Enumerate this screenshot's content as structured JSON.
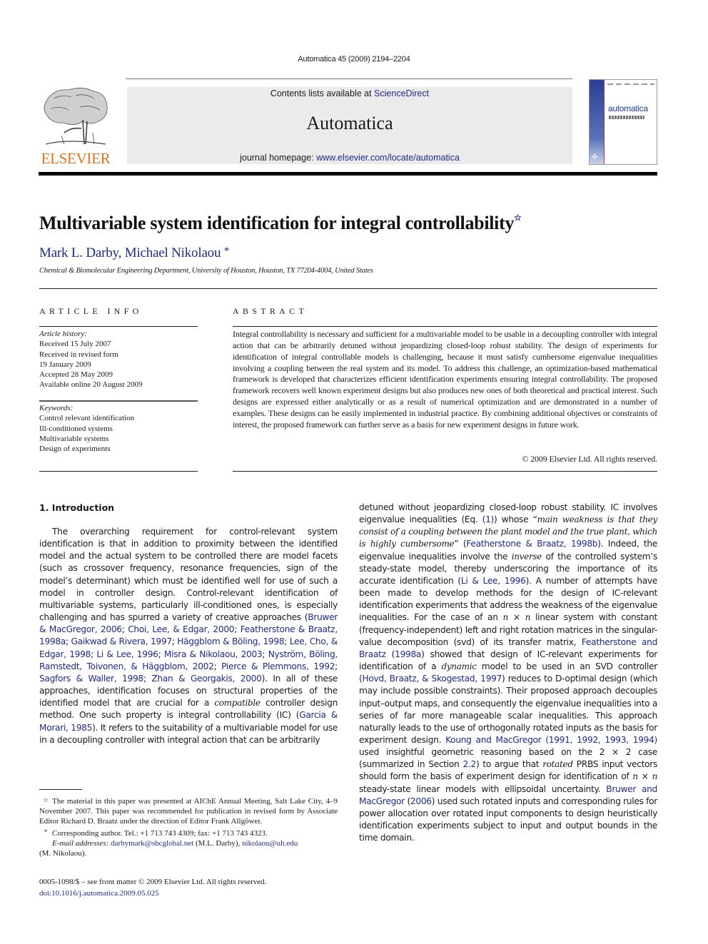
{
  "header": {
    "citation": "Automatica 45 (2009) 2194–2204",
    "contents_prefix": "Contents lists available at ",
    "contents_link": "ScienceDirect",
    "journal_name": "Automatica",
    "homepage_prefix": "journal homepage: ",
    "homepage_link": "www.elsevier.com/locate/automatica",
    "publisher_logo_text": "ELSEVIER",
    "cover_title": "automatica",
    "cover_logo": "IFAC",
    "colors": {
      "publisher_orange": "#e9711c",
      "link_blue": "#1f2a8a",
      "banner_gray": "#ebebeb"
    }
  },
  "article": {
    "title": "Multivariable system identification for integral controllability",
    "title_note_mark": "☆",
    "authors": "Mark L. Darby, Michael Nikolaou",
    "corresponding_mark": "*",
    "affiliation": "Chemical & Biomolecular Engineering Department, University of Houston, Houston, TX 77204-4004, United States"
  },
  "article_info": {
    "heading": "ARTICLE INFO",
    "history_label": "Article history:",
    "history": [
      "Received 15 July 2007",
      "Received in revised form",
      "19 January 2009",
      "Accepted 28 May 2009",
      "Available online 20 August 2009"
    ],
    "keywords_label": "Keywords:",
    "keywords": [
      "Control relevant identification",
      "Ill-conditioned systems",
      "Multivariable systems",
      "Design of experiments"
    ]
  },
  "abstract": {
    "heading": "ABSTRACT",
    "text": "Integral controllability is necessary and sufficient for a multivariable model to be usable in a decoupling controller with integral action that can be arbitrarily detuned without jeopardizing closed-loop robust stability. The design of experiments for identification of integral controllable models is challenging, because it must satisfy cumbersome eigenvalue inequalities involving a coupling between the real system and its model. To address this challenge, an optimization-based mathematical framework is developed that characterizes efficient identification experiments ensuring integral controllability. The proposed framework recovers well known experiment designs but also produces new ones of both theoretical and practical interest. Such designs are expressed either analytically or as a result of numerical optimization and are demonstrated in a number of examples. These designs can be easily implemented in industrial practice. By combining additional objectives or constraints of interest, the proposed framework can further serve as a basis for new experiment designs in future work.",
    "copyright": "© 2009 Elsevier Ltd. All rights reserved."
  },
  "introduction": {
    "heading": "1.  Introduction",
    "left_column": [
      {
        "t": "The overarching requirement for control-relevant system identification is that in addition to proximity between the identified model and the actual system to be controlled there are model facets (such as crossover frequency, resonance frequencies, sign of the model’s determinant) which must be identified well for use of such a model in controller design. Control-relevant identification of multivariable systems, particularly ill-conditioned ones, is especially challenging and has spurred a variety of creative approaches ("
      },
      {
        "l": "Bruwer & MacGregor, 2006"
      },
      {
        "t": "; "
      },
      {
        "l": "Choi, Lee, & Edgar, 2000"
      },
      {
        "t": "; "
      },
      {
        "l": "Featherstone & Braatz, 1998a"
      },
      {
        "t": "; "
      },
      {
        "l": "Gaikwad & Rivera, 1997"
      },
      {
        "t": "; "
      },
      {
        "l": "Häggblom & Böling, 1998"
      },
      {
        "t": "; "
      },
      {
        "l": "Lee, Cho, & Edgar, 1998"
      },
      {
        "t": "; "
      },
      {
        "l": "Li & Lee, 1996"
      },
      {
        "t": "; "
      },
      {
        "l": "Misra & Nikolaou, 2003"
      },
      {
        "t": "; "
      },
      {
        "l": "Nyström, Böling, Ramstedt, Toivonen, & Häggblom, 2002"
      },
      {
        "t": "; "
      },
      {
        "l": "Pierce & Plemmons, 1992"
      },
      {
        "t": "; "
      },
      {
        "l": "Sagfors & Waller, 1998"
      },
      {
        "t": "; "
      },
      {
        "l": "Zhan & Georgakis, 2000"
      },
      {
        "t": "). In all of these approaches, identification focuses on structural properties of the identified model that are crucial for a "
      },
      {
        "i": "compatible"
      },
      {
        "t": " controller design method. One such property is integral controllability (IC) ("
      },
      {
        "l": "Garcia & Morari, 1985"
      },
      {
        "t": "). It refers to the suitability of a multivariable model for use in a decoupling controller with integral action that can be arbitrarily"
      }
    ],
    "right_column": [
      {
        "t": "detuned without jeopardizing closed-loop robust stability. IC involves eigenvalue inequalities (Eq. "
      },
      {
        "l": "(1)"
      },
      {
        "t": ") whose “"
      },
      {
        "i": "main weakness is that they consist of a coupling between the plant model and the true plant, which is highly cumbersome"
      },
      {
        "t": "” ("
      },
      {
        "l": "Featherstone & Braatz, 1998b"
      },
      {
        "t": "). Indeed, the eigenvalue inequalities involve the "
      },
      {
        "i": "inverse"
      },
      {
        "t": " of the controlled system’s steady-state model, thereby underscoring the importance of its accurate identification ("
      },
      {
        "l": "Li & Lee, 1996"
      },
      {
        "t": "). A number of attempts have been made to develop methods for the design of IC-relevant identification experiments that address the weakness of the eigenvalue inequalities. For the case of an "
      },
      {
        "i": "n"
      },
      {
        "t": " × "
      },
      {
        "i": "n"
      },
      {
        "t": " linear system with constant (frequency-independent) left and right rotation matrices in the singular-value decomposition (svd) of its transfer matrix, "
      },
      {
        "l": "Featherstone and Braatz"
      },
      {
        "t": " ("
      },
      {
        "l": "1998a"
      },
      {
        "t": ") showed that design of IC-relevant experiments for identification of a "
      },
      {
        "i": "dynamic"
      },
      {
        "t": " model to be used in an SVD controller ("
      },
      {
        "l": "Hovd, Braatz, & Skogestad, 1997"
      },
      {
        "t": ") reduces to D-optimal design (which may include possible constraints). Their proposed approach decouples input–output maps, and consequently the eigenvalue inequalities into a series of far more manageable scalar inequalities. This approach naturally leads to the use of orthogonally rotated inputs as the basis for experiment design. "
      },
      {
        "l": "Koung and MacGregor (1991, 1992, 1993, 1994)"
      },
      {
        "t": " used insightful geometric reasoning based on the 2 × 2 case (summarized in Section "
      },
      {
        "l": "2.2"
      },
      {
        "t": ") to argue that "
      },
      {
        "i": "rotated"
      },
      {
        "t": " PRBS input vectors should form the basis of experiment design for identification of "
      },
      {
        "i": "n"
      },
      {
        "t": " × "
      },
      {
        "i": "n"
      },
      {
        "t": " steady-state linear models with ellipsoidal uncertainty. "
      },
      {
        "l": "Bruwer and MacGregor"
      },
      {
        "t": " ("
      },
      {
        "l": "2006"
      },
      {
        "t": ") used such rotated inputs and corresponding rules for power allocation over rotated input components to design heuristically identification experiments subject to input and output bounds in the time domain."
      }
    ]
  },
  "footnotes": {
    "star_mark": "☆",
    "star_note": "The material in this paper was presented at AIChE Annual Meeting, Salt Lake City, 4–9 November 2007. This paper was recommended for publication in revised form by Associate Editor Richard D. Braatz under the direction of Editor Frank Allgöwer.",
    "corresponding_mark": "*",
    "corresponding_note": "Corresponding author. Tel.: +1 713 743 4309; fax: +1 713 743 4323.",
    "email_label": "E-mail addresses:",
    "email_1": "darbymark@sbcglobal.net",
    "email_1_owner": " (M.L. Darby), ",
    "email_2": "nikolaou@uh.edu",
    "email_2_owner": "(M. Nikolaou).",
    "issn_line": "0005-1098/$ – see front matter © 2009 Elsevier Ltd. All rights reserved.",
    "doi": "doi:10.1016/j.automatica.2009.05.025"
  }
}
